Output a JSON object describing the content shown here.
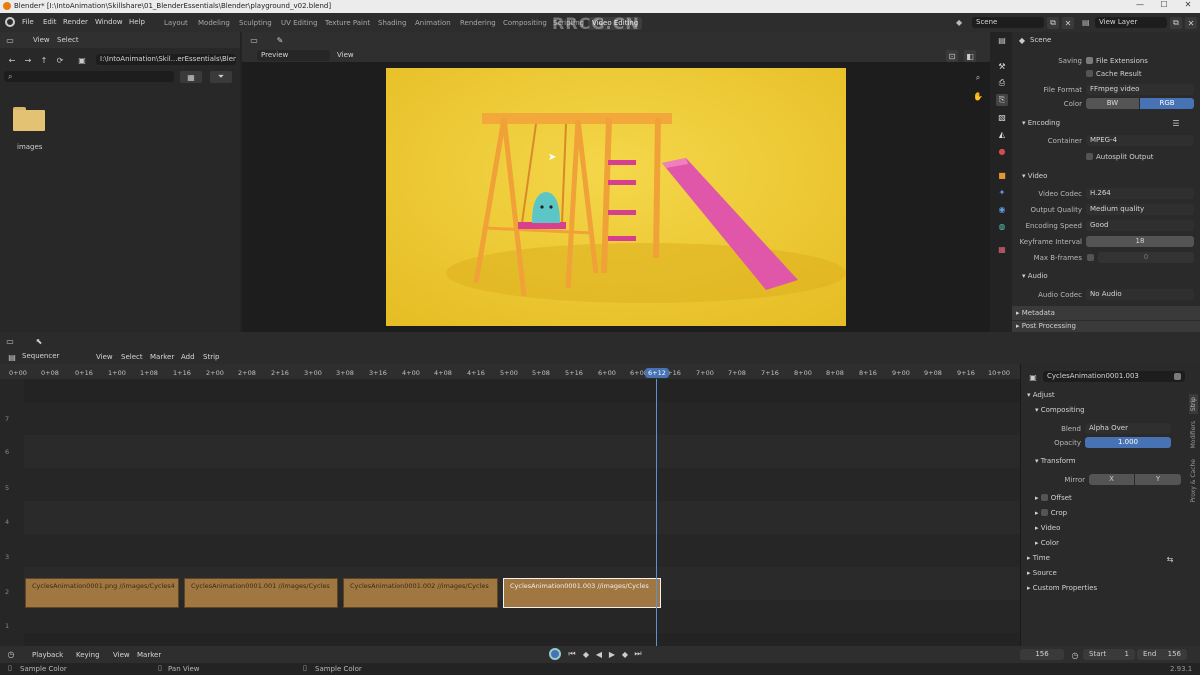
{
  "title_bar": {
    "text": "Blender* [I:\\IntoAnimation\\Skillshare\\01_BlenderEssentials\\Blender\\playground_v02.blend]",
    "minimize": "—",
    "maximize": "☐",
    "close": "✕"
  },
  "menu": {
    "items": [
      "File",
      "Edit",
      "Render",
      "Window",
      "Help"
    ],
    "workspace_tabs": [
      "Layout",
      "Modeling",
      "Sculpting",
      "UV Editing",
      "Texture Paint",
      "Shading",
      "Animation",
      "Rendering",
      "Compositing",
      "Scripting",
      "Video Editing"
    ],
    "active_tab": "Video Editing",
    "scene": "Scene",
    "view_layer": "View Layer"
  },
  "watermark": "RRCG.CN",
  "file_browser": {
    "menus": [
      "View",
      "Select"
    ],
    "path": "I:\\IntoAnimation\\Skil...erEssentials\\Blender\\",
    "search_placeholder": "",
    "folder_label": "images"
  },
  "preview": {
    "mode": "Preview",
    "view_menu": "View"
  },
  "properties": {
    "scene_label": "Scene",
    "saving_label": "Saving",
    "file_extensions": "File Extensions",
    "cache_result": "Cache Result",
    "file_format_label": "File Format",
    "file_format": "FFmpeg video",
    "color_label": "Color",
    "color_bw": "BW",
    "color_rgb": "RGB",
    "encoding": "Encoding",
    "container_label": "Container",
    "container": "MPEG-4",
    "autosplit": "Autosplit Output",
    "video": "Video",
    "video_codec_label": "Video Codec",
    "video_codec": "H.264",
    "output_quality_label": "Output Quality",
    "output_quality": "Medium quality",
    "encoding_speed_label": "Encoding Speed",
    "encoding_speed": "Good",
    "keyframe_interval_label": "Keyframe Interval",
    "keyframe_interval": "18",
    "max_bframes_label": "Max B-frames",
    "max_bframes": "0",
    "audio": "Audio",
    "audio_codec_label": "Audio Codec",
    "audio_codec": "No Audio",
    "metadata": "Metadata",
    "post_processing": "Post Processing"
  },
  "sequencer": {
    "mode": "Sequencer",
    "menus": [
      "View",
      "Select",
      "Marker",
      "Add",
      "Strip"
    ],
    "ticks": [
      "0+00",
      "0+08",
      "0+16",
      "1+00",
      "1+08",
      "1+16",
      "2+00",
      "2+08",
      "2+16",
      "3+00",
      "3+08",
      "3+16",
      "4+00",
      "4+08",
      "4+16",
      "5+00",
      "5+08",
      "5+16",
      "6+00",
      "6+08",
      "6+16",
      "7+00",
      "7+08",
      "7+16",
      "8+00",
      "8+08",
      "8+16",
      "9+00",
      "9+08",
      "9+16",
      "10+00"
    ],
    "current_frame_label": "6+12",
    "channels": [
      "7",
      "6",
      "5",
      "4",
      "3",
      "2",
      "1"
    ],
    "strips": [
      "CyclesAnimation0001.png  //images/Cycles4",
      "CyclesAnimation0001.001  //images/Cycles",
      "CyclesAnimation0001.002  //images/Cycles",
      "CyclesAnimation0001.003  //images/Cycles"
    ]
  },
  "strip_panel": {
    "strip_name": "CyclesAnimation0001.003",
    "adjust": "Adjust",
    "compositing": "Compositing",
    "blend_label": "Blend",
    "blend": "Alpha Over",
    "opacity_label": "Opacity",
    "opacity": "1.000",
    "transform": "Transform",
    "mirror_label": "Mirror",
    "mirror_x": "X",
    "mirror_y": "Y",
    "offset": "Offset",
    "crop": "Crop",
    "video": "Video",
    "color": "Color",
    "time": "Time",
    "source": "Source",
    "custom_properties": "Custom Properties",
    "side_tabs": [
      "Strip",
      "Modifiers",
      "Proxy & Cache"
    ]
  },
  "timeline": {
    "menus": [
      "Playback",
      "Keying",
      "View",
      "Marker"
    ],
    "current_frame": "156",
    "start_label": "Start",
    "start": "1",
    "end_label": "End",
    "end": "156"
  },
  "status_bar": {
    "left": "Sample Color",
    "middle": "Pan View",
    "right": "Sample Color",
    "version": "2.93.1"
  }
}
